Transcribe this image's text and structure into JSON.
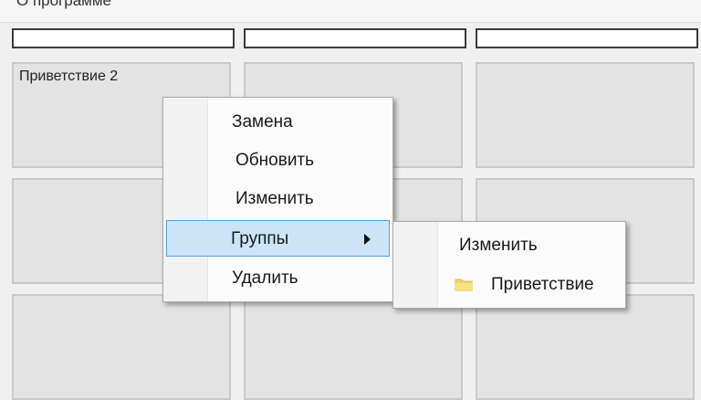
{
  "window": {
    "title": "О программе"
  },
  "header_fields": [
    {
      "value": ""
    },
    {
      "value": ""
    },
    {
      "value": ""
    }
  ],
  "grid": {
    "rows": [
      [
        {
          "label": "Приветствие 2"
        },
        {
          "label": ""
        },
        {
          "label": ""
        }
      ],
      [
        {
          "label": ""
        },
        {
          "label": ""
        },
        {
          "label": ""
        }
      ],
      [
        {
          "label": ""
        },
        {
          "label": ""
        },
        {
          "label": ""
        }
      ]
    ]
  },
  "context_menu": {
    "items": [
      {
        "label": "Замена",
        "selected": false,
        "has_submenu": false
      },
      {
        "label": "Обновить",
        "selected": false,
        "has_submenu": false
      },
      {
        "label": "Изменить",
        "selected": false,
        "has_submenu": false
      },
      {
        "label": "Группы",
        "selected": true,
        "has_submenu": true
      },
      {
        "label": "Удалить",
        "selected": false,
        "has_submenu": false
      }
    ]
  },
  "submenu": {
    "items": [
      {
        "label": "Изменить",
        "icon": null
      },
      {
        "label": "Приветствие",
        "icon": "folder-icon"
      }
    ]
  },
  "colors": {
    "selection_fill": "#cce4f7",
    "selection_border": "#5b9fd6",
    "cell_fill": "#e3e3e3",
    "folder": "#f2d46b"
  }
}
